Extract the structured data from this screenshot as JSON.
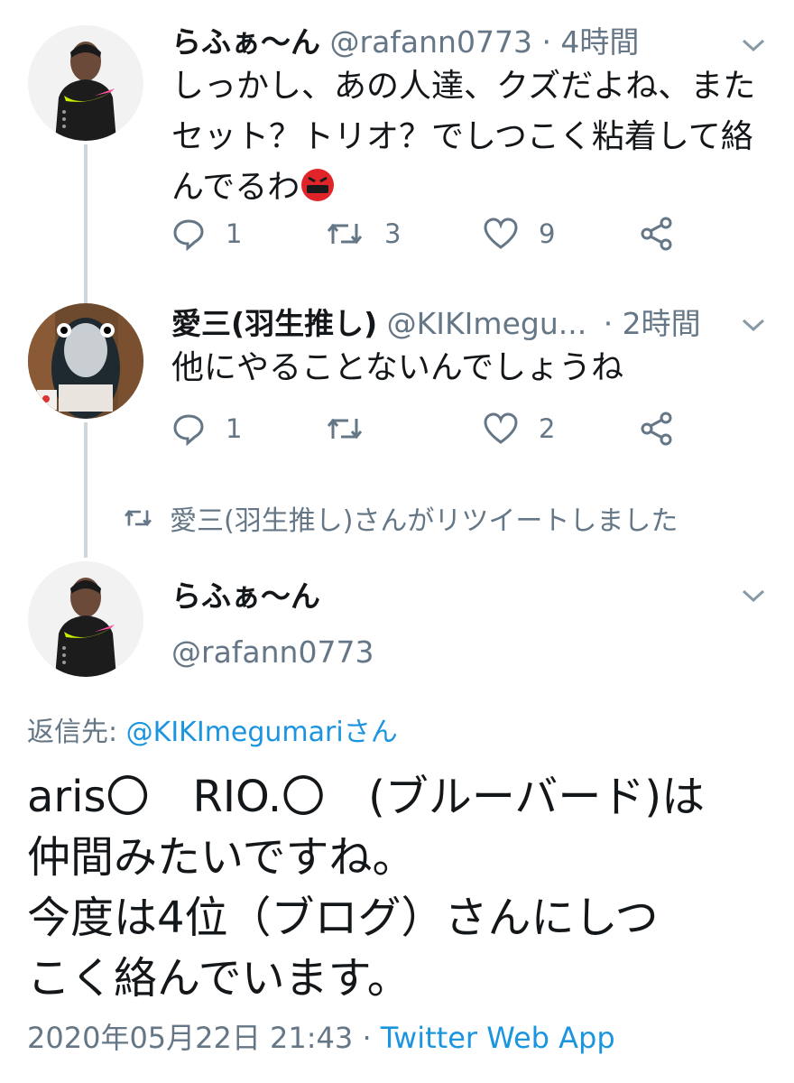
{
  "tweets": [
    {
      "name": "らふぁ〜ん",
      "handle": "@rafann0773",
      "time": "· 4時間",
      "text": [
        "しっかし、あの人達、クズだよね、また",
        "セット？トリオ？でしつこく粘着して絡",
        "んでるわ"
      ],
      "emoji": "angry-symbols-face",
      "replies": "1",
      "retweets": "3",
      "likes": "9"
    },
    {
      "name": "愛三(羽生推し)",
      "handle": "@KIKImegu...",
      "time": "· 2時間",
      "text": [
        "他にやることないんでしょうね"
      ],
      "replies": "1",
      "retweets": "",
      "likes": "2"
    }
  ],
  "retweet_notice": "愛三(羽生推し)さんがリツイートしました",
  "main_tweet": {
    "name": "らふぁ〜ん",
    "handle": "@rafann0773",
    "reply_label": "返信先: ",
    "reply_target": "@KIKImegumariさん",
    "lines": [
      "aris〇　RIO.〇　(ブルーバード)は",
      "仲間みたいですね。",
      "今度は4位（ブログ）さんにしつ",
      "こく絡んでいます。"
    ],
    "timestamp": "2020年05月22日 21:43 · ",
    "app": "Twitter Web App"
  },
  "colors": {
    "text": "#14171a",
    "meta": "#657786",
    "link": "#1b95e0",
    "thread_line": "#ccd6dd"
  }
}
